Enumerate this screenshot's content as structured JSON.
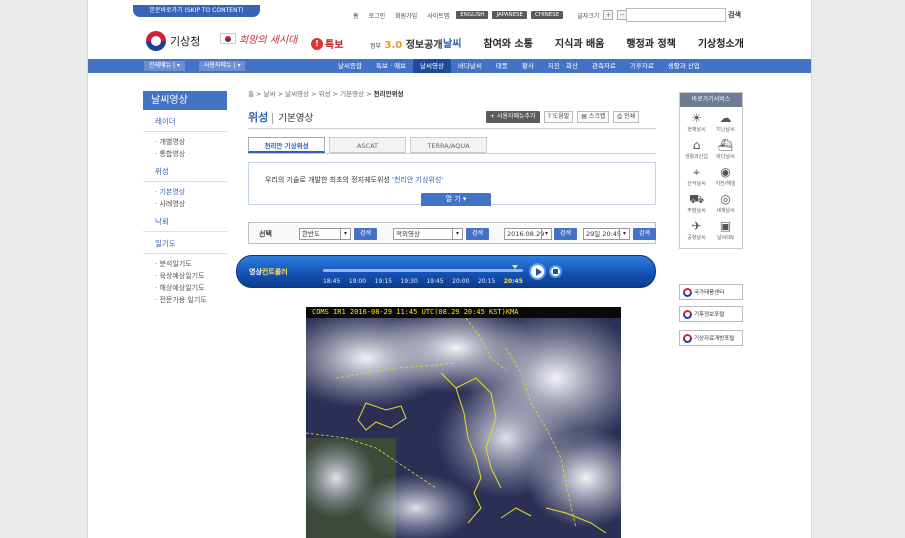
{
  "skip": "본문바로가기 (SKIP TO CONTENT)",
  "util": {
    "links": [
      "홈",
      "로그인",
      "회원가입",
      "사이트맵"
    ],
    "langs": [
      "ENGLISH",
      "JAPANESE",
      "CHINESE"
    ],
    "fontsize_label": "글자크기",
    "plus": "+",
    "minus": "−",
    "search_btn": "검색"
  },
  "header": {
    "logo": "기상청",
    "slogan": "희망의 새시대",
    "alert": "특보",
    "gov_small": "정부",
    "gov_num": "3.0",
    "gov_text": "정보공개",
    "gnb": [
      "날씨",
      "참여와 소통",
      "지식과 배움",
      "행정과 정책",
      "기상청소개"
    ]
  },
  "subnav": {
    "all_menu": "전체메뉴",
    "user_menu": "사용자메뉴",
    "items": [
      "날씨종합",
      "특보 · 예보",
      "날씨영상",
      "바다날씨",
      "태풍",
      "황사",
      "지진 · 화산",
      "관측자료",
      "기후자료",
      "생활과 산업"
    ],
    "active": "날씨영상"
  },
  "lnb": {
    "title": "날씨영상",
    "sections": [
      {
        "name": "레이더",
        "subs": [
          {
            "label": "· 개별영상",
            "on": false
          },
          {
            "label": "· 통합영상",
            "on": false
          }
        ]
      },
      {
        "name": "위성",
        "subs": [
          {
            "label": "· 기본영상",
            "on": true
          },
          {
            "label": "· 사례영상",
            "on": false
          }
        ]
      },
      {
        "name": "낙뢰",
        "subs": []
      },
      {
        "name": "일기도",
        "subs": [
          {
            "label": "· 분석일기도",
            "on": false
          },
          {
            "label": "· 육상예상일기도",
            "on": false
          },
          {
            "label": "· 해상예상일기도",
            "on": false
          },
          {
            "label": "· 전문가용 일기도",
            "on": false
          }
        ]
      }
    ]
  },
  "breadcrumb": {
    "path": "홈 > 날씨 > 날씨영상 > 위성 > 기본영상 > ",
    "current": "천리안위성"
  },
  "page": {
    "title": "위성",
    "subtitle": "기본영상"
  },
  "tools": {
    "news": "사용자매뉴추가",
    "help": "도움말",
    "scrap": "스크랩",
    "print": "인쇄"
  },
  "tabs": [
    {
      "label": "천리안 기상위성",
      "on": true
    },
    {
      "label": "ASCAT",
      "on": false
    },
    {
      "label": "TERRA/AQUA",
      "on": false
    }
  ],
  "intro": {
    "text": "우리의 기술로 개발한 최초의 정지궤도위성 ",
    "highlight": "'천리안 기상위성'",
    "open_btn": "열 기 ▾"
  },
  "selbar": {
    "label": "선택",
    "region": "한반도",
    "channel": "적외영상",
    "date": "2016.08.29",
    "time": "29일 20:45",
    "search": "검색"
  },
  "controller": {
    "label_a": "영상",
    "label_b": "컨트롤러",
    "times": [
      "18:45",
      "19:00",
      "19:15",
      "19:30",
      "19:45",
      "20:00",
      "20:15",
      "20:45"
    ]
  },
  "satellite": {
    "caption": "COMS IR1 2016-08-29 11:45 UTC(08.29 20:45 KST)KMA"
  },
  "quick": {
    "title": "바로가기서비스",
    "items": [
      {
        "icon": "sun-icon",
        "glyph": "☀",
        "label": "현재날씨"
      },
      {
        "icon": "cloud-icon",
        "glyph": "☁",
        "label": "지난날씨"
      },
      {
        "icon": "house-icon",
        "glyph": "⌂",
        "label": "생활과산업"
      },
      {
        "icon": "ship-icon",
        "glyph": "⛴",
        "label": "바다날씨"
      },
      {
        "icon": "pin-icon",
        "glyph": "⌖",
        "label": "산악날씨"
      },
      {
        "icon": "signal-icon",
        "glyph": "◉",
        "label": "지진/해일"
      },
      {
        "icon": "car-icon",
        "glyph": "⛟",
        "label": "주말날씨"
      },
      {
        "icon": "globe-icon",
        "glyph": "◎",
        "label": "세계날씨"
      },
      {
        "icon": "plane-icon",
        "glyph": "✈",
        "label": "공항날씨"
      },
      {
        "icon": "tv-icon",
        "glyph": "▣",
        "label": "날씨ON"
      }
    ],
    "banners": [
      "국가태풍센터",
      "기후정보포털",
      "기상자료개방포털"
    ]
  }
}
